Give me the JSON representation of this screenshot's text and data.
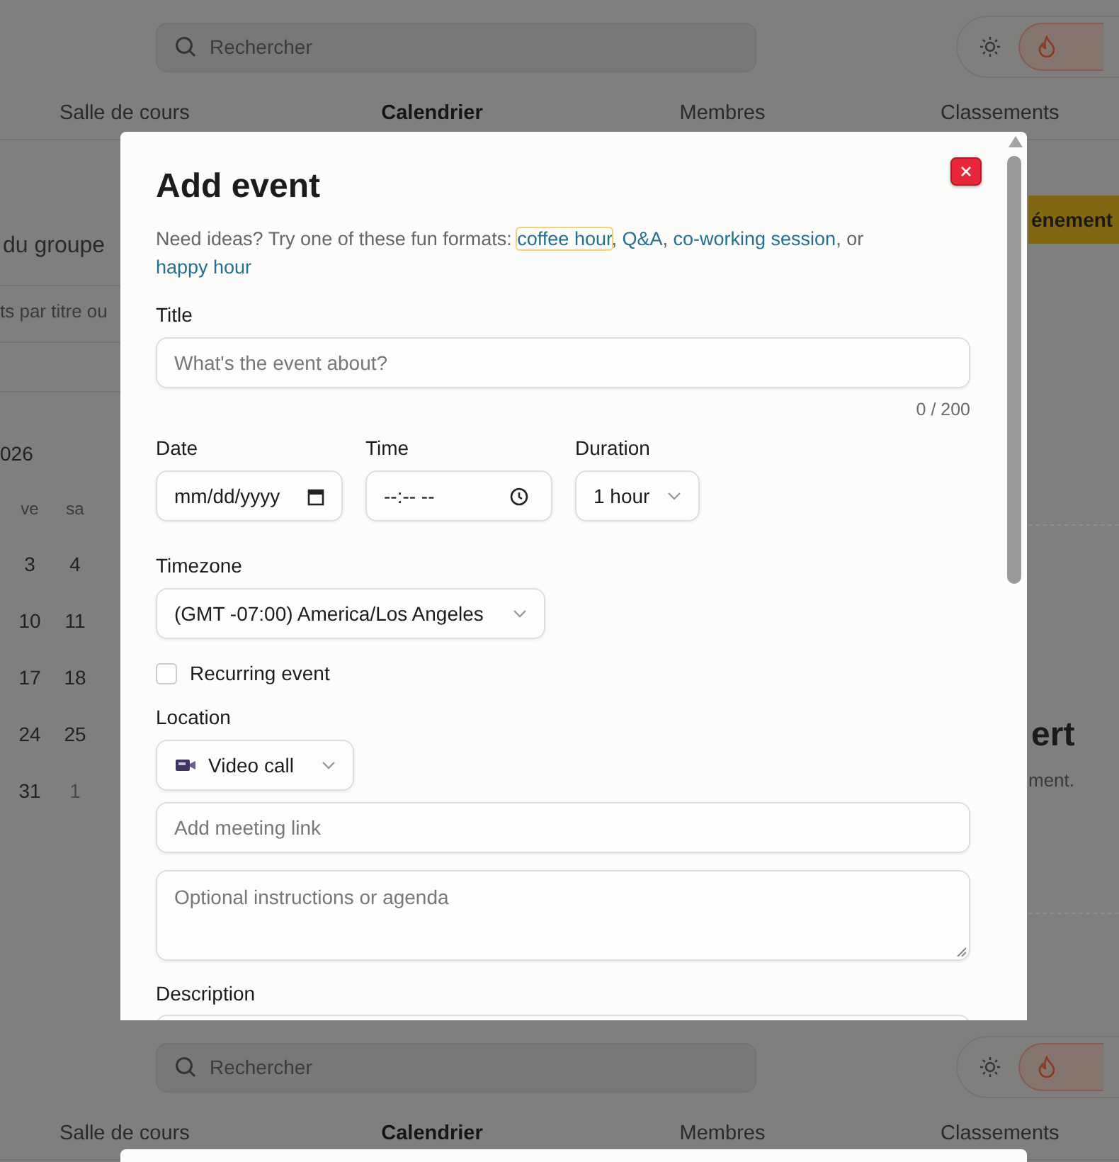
{
  "page": {
    "search_placeholder": "Rechercher",
    "nav": [
      {
        "label": "Salle de cours",
        "selected": false
      },
      {
        "label": "Calendrier",
        "selected": true
      },
      {
        "label": "Membres",
        "selected": false
      },
      {
        "label": "Classements",
        "selected": false
      }
    ],
    "group_title": "du groupe",
    "filter_placeholder": "ts par titre ou",
    "calendar": {
      "month": "026",
      "weekdays": [
        "ve",
        "sa"
      ],
      "weeks": [
        [
          {
            "day": "3",
            "other_month": false
          },
          {
            "day": "4",
            "other_month": false
          }
        ],
        [
          {
            "day": "10",
            "other_month": false
          },
          {
            "day": "11",
            "other_month": false
          }
        ],
        [
          {
            "day": "17",
            "other_month": false
          },
          {
            "day": "18",
            "other_month": false
          }
        ],
        [
          {
            "day": "24",
            "other_month": false
          },
          {
            "day": "25",
            "other_month": false
          }
        ],
        [
          {
            "day": "31",
            "other_month": false
          },
          {
            "day": "1",
            "other_month": true
          }
        ]
      ]
    },
    "create_button": "énement",
    "empty_title": "ert",
    "empty_text": "ment."
  },
  "modal": {
    "title": "Add event",
    "intro": [
      {
        "kind": "text",
        "text": "Need ideas? Try one of these fun formats: "
      },
      {
        "kind": "link",
        "text": "coffee hour",
        "focused": true
      },
      {
        "kind": "text",
        "text": ", "
      },
      {
        "kind": "link",
        "text": "Q&A",
        "focused": false
      },
      {
        "kind": "text",
        "text": ", "
      },
      {
        "kind": "link",
        "text": "co-working session",
        "focused": false
      },
      {
        "kind": "text",
        "text": ", or "
      },
      {
        "kind": "link",
        "text": "happy hour",
        "focused": false
      }
    ],
    "title_label": "Title",
    "title_placeholder": "What's the event about?",
    "counter": "0 / 200",
    "date_label": "Date",
    "date_placeholder": "mm/dd/yyyy",
    "time_label": "Time",
    "time_placeholder": "--:-- --",
    "duration_label": "Duration",
    "duration": "1 hour",
    "timezone_label": "Timezone",
    "timezone": "(GMT -07:00) America/Los Angeles",
    "recurring": {
      "label": "Recurring event",
      "checked": false
    },
    "location_label": "Location",
    "location": "Video call",
    "link_placeholder": "Add meeting link",
    "agenda_placeholder": "Optional instructions or agenda",
    "description_label": "Description"
  },
  "repeat_band": {
    "search_placeholder": "Rechercher",
    "nav": [
      {
        "label": "Salle de cours",
        "selected": false
      },
      {
        "label": "Calendrier",
        "selected": true
      },
      {
        "label": "Membres",
        "selected": false
      },
      {
        "label": "Classements",
        "selected": false
      }
    ]
  }
}
